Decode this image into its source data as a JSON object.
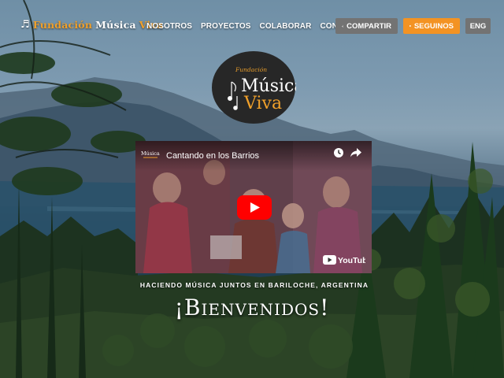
{
  "brand": {
    "note_glyph": "♬",
    "word1": "Fundación",
    "word2": "Música",
    "word3": "Viva"
  },
  "nav": {
    "items": [
      {
        "label": "NOSOTROS"
      },
      {
        "label": "PROYECTOS"
      },
      {
        "label": "COLABORAR"
      },
      {
        "label": "CONTACTO"
      }
    ]
  },
  "actions": {
    "share_label": "COMPARTIR",
    "follow_label": "SEGUINOS",
    "lang_label": "ENG"
  },
  "logo": {
    "small": "Fundación",
    "big1": "Música",
    "big2": "Viva"
  },
  "video": {
    "title": "Cantando en los Barrios",
    "channel_logo": "Música Viva",
    "platform": "YouTube"
  },
  "hero": {
    "tagline": "HACIENDO MÚSICA JUNTOS EN BARILOCHE, ARGENTINA",
    "welcome": "¡Bienvenidos!"
  },
  "colors": {
    "accent_orange": "#f39323",
    "button_gray": "#737373",
    "youtube_red": "#ff0000"
  }
}
